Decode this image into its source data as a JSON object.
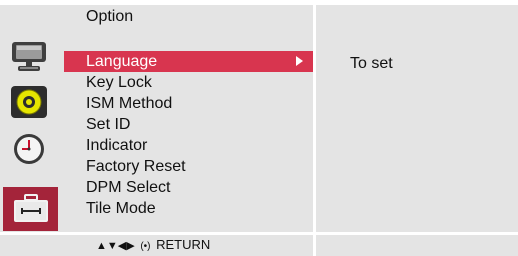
{
  "header": {
    "title": "Option"
  },
  "menu": {
    "items": [
      {
        "label": "Language",
        "selected": true
      },
      {
        "label": "Key Lock",
        "selected": false
      },
      {
        "label": "ISM Method",
        "selected": false
      },
      {
        "label": "Set ID",
        "selected": false
      },
      {
        "label": "Indicator",
        "selected": false
      },
      {
        "label": "Factory Reset",
        "selected": false
      },
      {
        "label": "DPM Select",
        "selected": false
      },
      {
        "label": "Tile Mode",
        "selected": false
      }
    ]
  },
  "info": {
    "text": "To set"
  },
  "footer": {
    "nav_arrows": "▲▼◀▶",
    "ok_symbol": "(•)",
    "return_label": "RETURN"
  },
  "categories": [
    {
      "icon": "monitor-icon"
    },
    {
      "icon": "audio-icon"
    },
    {
      "icon": "clock-icon"
    },
    {
      "icon": "toolbox-icon"
    }
  ],
  "colors": {
    "panel_bg": "#e4e4e4",
    "highlight": "#d8354f",
    "active_category": "#a4243a"
  }
}
